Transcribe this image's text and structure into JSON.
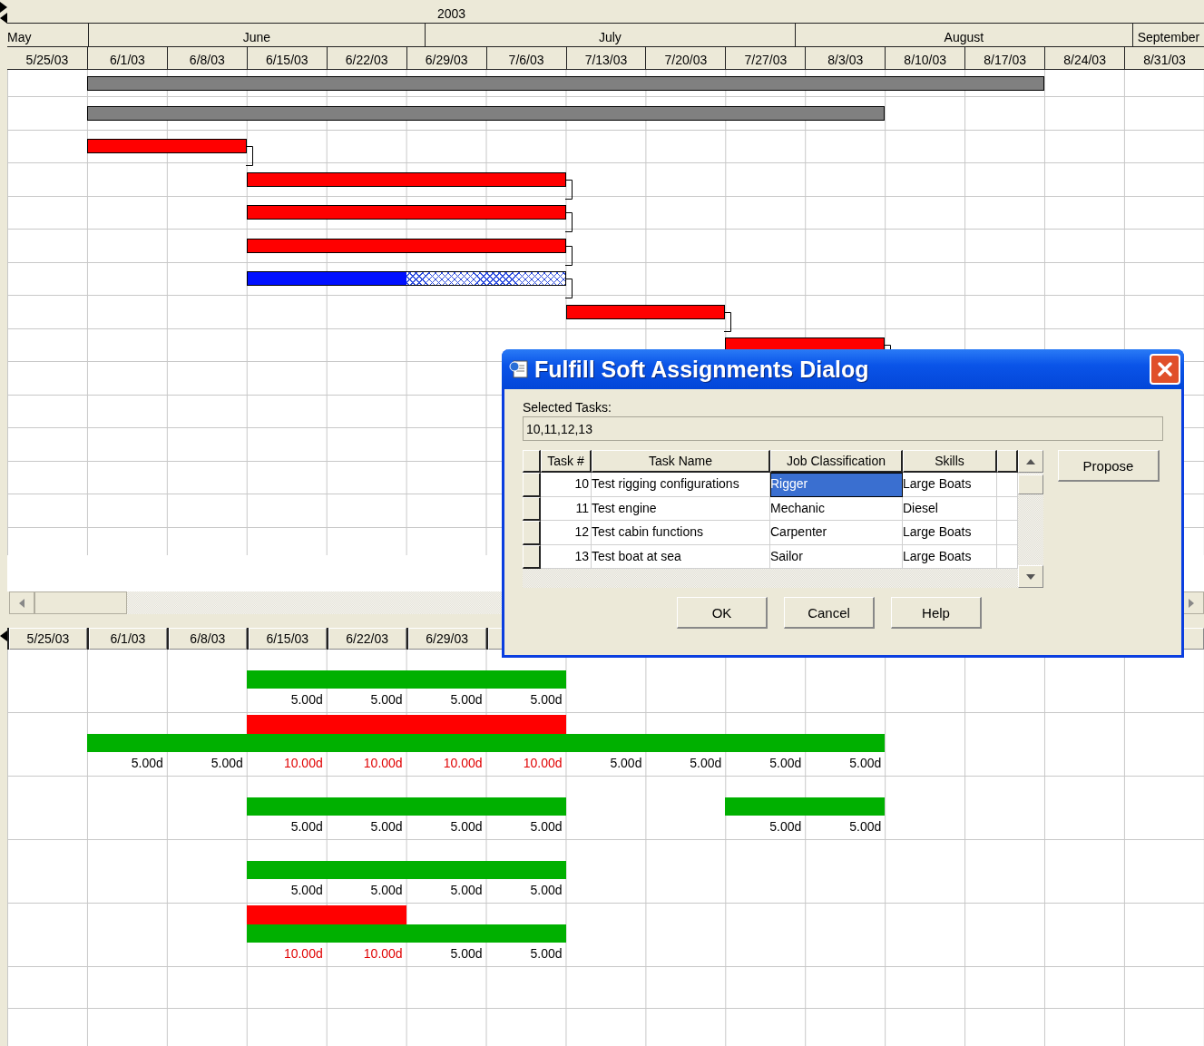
{
  "timeline": {
    "year": "2003",
    "months": [
      "May",
      "June",
      "July",
      "August",
      "September"
    ],
    "weeks": [
      "5/25/03",
      "6/1/03",
      "6/8/03",
      "6/15/03",
      "6/22/03",
      "6/29/03",
      "7/6/03",
      "7/13/03",
      "7/20/03",
      "7/27/03",
      "8/3/03",
      "8/10/03",
      "8/17/03",
      "8/24/03",
      "8/31/03"
    ]
  },
  "gantt_bars": [
    {
      "kind": "summary",
      "linked": false
    },
    {
      "kind": "summary",
      "linked": false
    },
    {
      "kind": "task",
      "linked": true
    },
    {
      "kind": "task",
      "linked": true
    },
    {
      "kind": "task",
      "linked": true
    },
    {
      "kind": "task",
      "linked": true
    },
    {
      "kind": "progress",
      "level": 0.5,
      "linked": true
    },
    {
      "kind": "task",
      "linked": true
    },
    {
      "kind": "task",
      "linked": true
    }
  ],
  "lower_pane": {
    "weeks": [
      "5/25/03",
      "6/1/03",
      "6/8/03",
      "6/15/03",
      "6/22/03",
      "6/29/03"
    ],
    "resources": [
      {
        "segments": [
          {
            "cells": [
              {
                "value": "5.00d",
                "over": false
              },
              {
                "value": "5.00d",
                "over": false
              },
              {
                "value": "5.00d",
                "over": false
              },
              {
                "value": "5.00d",
                "over": false
              }
            ]
          }
        ]
      },
      {
        "segments": [
          {
            "cells": [
              {
                "value": "5.00d",
                "over": false
              },
              {
                "value": "5.00d",
                "over": false
              },
              {
                "value": "10.00d",
                "over": true
              },
              {
                "value": "10.00d",
                "over": true
              },
              {
                "value": "10.00d",
                "over": true
              },
              {
                "value": "10.00d",
                "over": true
              },
              {
                "value": "5.00d",
                "over": false
              },
              {
                "value": "5.00d",
                "over": false
              },
              {
                "value": "5.00d",
                "over": false
              },
              {
                "value": "5.00d",
                "over": false
              }
            ]
          }
        ]
      },
      {
        "segments": [
          {
            "cells": [
              {
                "value": "5.00d",
                "over": false
              },
              {
                "value": "5.00d",
                "over": false
              },
              {
                "value": "5.00d",
                "over": false
              },
              {
                "value": "5.00d",
                "over": false
              }
            ]
          },
          {
            "cells": [
              {
                "value": "5.00d",
                "over": false
              },
              {
                "value": "5.00d",
                "over": false
              }
            ]
          }
        ]
      },
      {
        "segments": [
          {
            "cells": [
              {
                "value": "5.00d",
                "over": false
              },
              {
                "value": "5.00d",
                "over": false
              },
              {
                "value": "5.00d",
                "over": false
              },
              {
                "value": "5.00d",
                "over": false
              }
            ]
          }
        ]
      },
      {
        "segments": [
          {
            "cells": [
              {
                "value": "10.00d",
                "over": true
              },
              {
                "value": "10.00d",
                "over": true
              },
              {
                "value": "5.00d",
                "over": false
              },
              {
                "value": "5.00d",
                "over": false
              }
            ]
          }
        ]
      }
    ]
  },
  "dialog": {
    "title": "Fulfill Soft Assignments Dialog",
    "selected_tasks_label": "Selected Tasks:",
    "selected_tasks": "10,11,12,13",
    "columns": [
      "Task #",
      "Task Name",
      "Job Classification",
      "Skills"
    ],
    "rows": [
      {
        "task_no": "10",
        "task_name": "Test rigging configurations",
        "job_classification": "Rigger",
        "skills": "Large Boats",
        "selected": true
      },
      {
        "task_no": "11",
        "task_name": "Test engine",
        "job_classification": "Mechanic",
        "skills": "Diesel",
        "selected": false
      },
      {
        "task_no": "12",
        "task_name": "Test cabin functions",
        "job_classification": "Carpenter",
        "skills": "Large Boats",
        "selected": false
      },
      {
        "task_no": "13",
        "task_name": "Test boat at sea",
        "job_classification": "Sailor",
        "skills": "Large Boats",
        "selected": false
      }
    ],
    "buttons": [
      {
        "label": "Propose",
        "kind": "side"
      },
      {
        "label": "OK",
        "kind": "footer"
      },
      {
        "label": "Cancel",
        "kind": "footer"
      },
      {
        "label": "Help",
        "kind": "footer"
      }
    ]
  }
}
